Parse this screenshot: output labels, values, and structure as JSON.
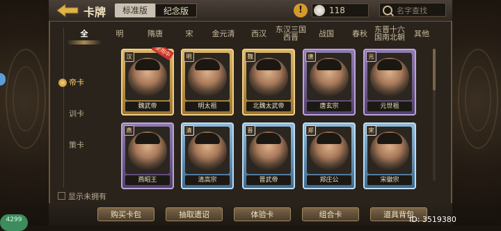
{
  "header": {
    "title": "卡牌",
    "version_tabs": [
      "标准版",
      "纪念版"
    ],
    "alert_symbol": "!",
    "coin_count": "118",
    "search_placeholder": "名字查找"
  },
  "era_tabs": [
    {
      "label": "全",
      "active": true
    },
    {
      "label": "明"
    },
    {
      "label": "隋唐"
    },
    {
      "label": "宋"
    },
    {
      "label": "金元清"
    },
    {
      "label": "西汉"
    },
    {
      "label": "东汉三国西晋"
    },
    {
      "label": "战国"
    },
    {
      "label": "春秋"
    },
    {
      "label": "东晋十六国南北朝"
    },
    {
      "label": "其他"
    }
  ],
  "side_nav": [
    {
      "label": "帝卡",
      "active": true
    },
    {
      "label": "训卡"
    },
    {
      "label": "策卡"
    }
  ],
  "show_unowned_label": "显示未拥有",
  "cards": [
    {
      "name": "魏武帝",
      "badge": "汉",
      "rarity": "gold",
      "ribbon": "使用中"
    },
    {
      "name": "明太祖",
      "badge": "明",
      "rarity": "gold"
    },
    {
      "name": "北魏太武帝",
      "badge": "魏",
      "rarity": "gold"
    },
    {
      "name": "唐玄宗",
      "badge": "唐",
      "rarity": "purple"
    },
    {
      "name": "元世祖",
      "badge": "元",
      "rarity": "purple"
    },
    {
      "name": "燕昭王",
      "badge": "燕",
      "rarity": "purple"
    },
    {
      "name": "清高宗",
      "badge": "清",
      "rarity": "blue"
    },
    {
      "name": "晋武帝",
      "badge": "晋",
      "rarity": "blue"
    },
    {
      "name": "郑庄公",
      "badge": "郑",
      "rarity": "blue"
    },
    {
      "name": "宋徽宗",
      "badge": "宋",
      "rarity": "blue"
    }
  ],
  "bottom_buttons": [
    "购买卡包",
    "抽取遗诏",
    "体验卡",
    "组合卡",
    "道具背包"
  ],
  "uid": "ID: 3519380",
  "corner_badge": "4299"
}
